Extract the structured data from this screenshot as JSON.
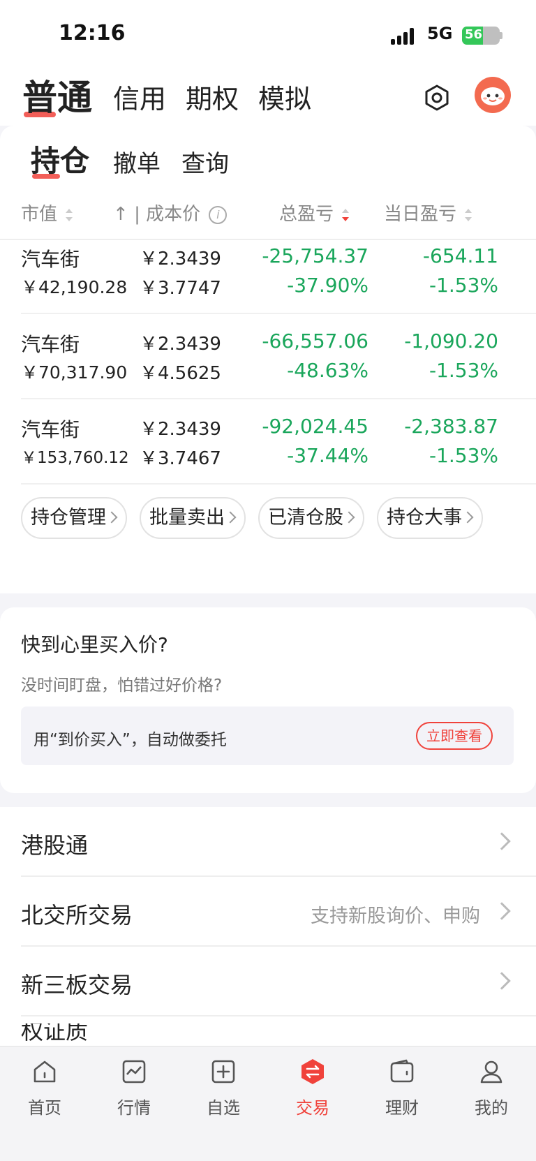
{
  "status": {
    "time": "12:16",
    "network": "5G",
    "battery": "56",
    "battery_level": 0.56
  },
  "top_tabs": [
    "普通",
    "信用",
    "期权",
    "模拟"
  ],
  "sub_tabs": [
    "持仓",
    "撤单",
    "查询"
  ],
  "columns": {
    "market_value": "市值",
    "cost_sep": "| 成本价",
    "total_pl": "总盈亏",
    "daily_pl": "当日盈亏"
  },
  "holdings": [
    {
      "name": "汽车街",
      "market_value": "￥42,190.28",
      "price": "￥2.3439",
      "cost": "￥3.7747",
      "total_pl": "-25,754.37",
      "total_pct": "-37.90%",
      "daily_pl": "-654.11",
      "daily_pct": "-1.53%"
    },
    {
      "name": "汽车街",
      "market_value": "￥70,317.90",
      "price": "￥2.3439",
      "cost": "￥4.5625",
      "total_pl": "-66,557.06",
      "total_pct": "-48.63%",
      "daily_pl": "-1,090.20",
      "daily_pct": "-1.53%"
    },
    {
      "name": "汽车街",
      "market_value": "￥153,760.12",
      "price": "￥2.3439",
      "cost": "￥3.7467",
      "total_pl": "-92,024.45",
      "total_pct": "-37.44%",
      "daily_pl": "-2,383.87",
      "daily_pct": "-1.53%"
    }
  ],
  "actions": [
    "持仓管理",
    "批量卖出",
    "已清仓股",
    "持仓大事"
  ],
  "promo": {
    "title": "快到心里买入价?",
    "subtitle": "没时间盯盘，怕错过好价格?",
    "box_text": "用“到价买入”，自动做委托",
    "button": "立即查看"
  },
  "list": [
    {
      "label": "港股通",
      "hint": ""
    },
    {
      "label": "北交所交易",
      "hint": "支持新股询价、申购"
    },
    {
      "label": "新三板交易",
      "hint": ""
    }
  ],
  "list_peek": "权证质押",
  "bottom_nav": [
    {
      "label": "首页",
      "icon": "home-icon"
    },
    {
      "label": "行情",
      "icon": "chart-icon"
    },
    {
      "label": "自选",
      "icon": "add-square-icon"
    },
    {
      "label": "交易",
      "icon": "trade-icon"
    },
    {
      "label": "理财",
      "icon": "wallet-icon"
    },
    {
      "label": "我的",
      "icon": "user-icon"
    }
  ],
  "colors": {
    "accent": "#f0423b",
    "loss_green": "#1aa65b"
  }
}
